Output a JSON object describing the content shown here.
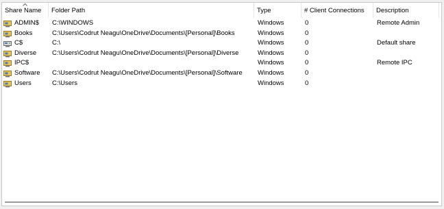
{
  "columns": {
    "share_name": "Share Name",
    "folder_path": "Folder Path",
    "type": "Type",
    "client_connections": "# Client Connections",
    "description": "Description"
  },
  "sort": {
    "column": "share_name",
    "direction": "ascending"
  },
  "shares": [
    {
      "icon": "admin-share-icon",
      "name": "ADMIN$",
      "path": "C:\\WINDOWS",
      "type": "Windows",
      "connections": "0",
      "description": "Remote Admin"
    },
    {
      "icon": "folder-share-icon",
      "name": "Books",
      "path": "C:\\Users\\Codrut Neagu\\OneDrive\\Documents\\[Personal]\\Books",
      "type": "Windows",
      "connections": "0",
      "description": ""
    },
    {
      "icon": "drive-share-icon",
      "name": "C$",
      "path": "C:\\",
      "type": "Windows",
      "connections": "0",
      "description": "Default share"
    },
    {
      "icon": "folder-share-icon",
      "name": "Diverse",
      "path": "C:\\Users\\Codrut Neagu\\OneDrive\\Documents\\[Personal]\\Diverse",
      "type": "Windows",
      "connections": "0",
      "description": ""
    },
    {
      "icon": "ipc-share-icon",
      "name": "IPC$",
      "path": "",
      "type": "Windows",
      "connections": "0",
      "description": "Remote IPC"
    },
    {
      "icon": "folder-share-icon",
      "name": "Software",
      "path": "C:\\Users\\Codrut Neagu\\OneDrive\\Documents\\[Personal]\\Software",
      "type": "Windows",
      "connections": "0",
      "description": ""
    },
    {
      "icon": "folder-share-icon",
      "name": "Users",
      "path": "C:\\Users",
      "type": "Windows",
      "connections": "0",
      "description": ""
    }
  ]
}
